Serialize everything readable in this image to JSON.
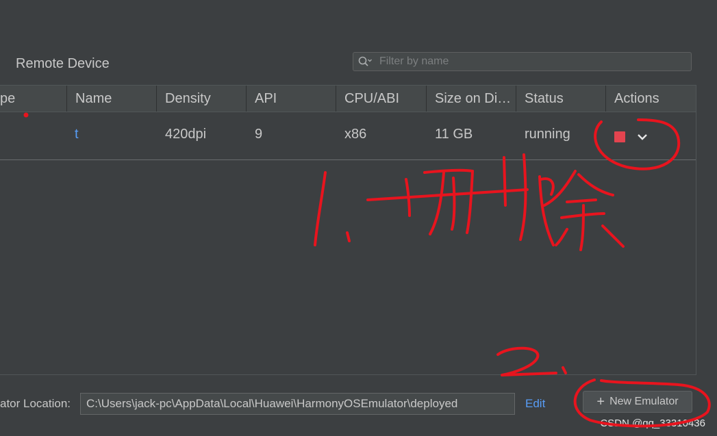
{
  "header": {
    "title": "Remote Device",
    "filter_placeholder": "Filter by name",
    "filter_icon": "search-icon"
  },
  "table": {
    "columns": [
      "pe",
      "Name",
      "Density",
      "API",
      "CPU/ABI",
      "Size on Di…",
      "Status",
      "Actions"
    ],
    "rows": [
      {
        "type": "",
        "name": "t",
        "density": "420dpi",
        "api": "9",
        "cpu": "x86",
        "size": "11 GB",
        "status": "running",
        "actions": [
          "stop-icon",
          "chevron-down-icon"
        ]
      }
    ]
  },
  "footer": {
    "location_label": "ator Location:",
    "location_value": "C:\\Users\\jack-pc\\AppData\\Local\\Huawei\\HarmonyOSEmulator\\deployed",
    "edit_label": "Edit",
    "new_emulator_label": "New Emulator",
    "new_emulator_icon": "plus-icon"
  },
  "watermark": "CSDN @qq_33310436",
  "colors": {
    "background": "#3c3f41",
    "stop": "#e3444f",
    "link": "#589df6",
    "annotation": "#e8141e"
  }
}
